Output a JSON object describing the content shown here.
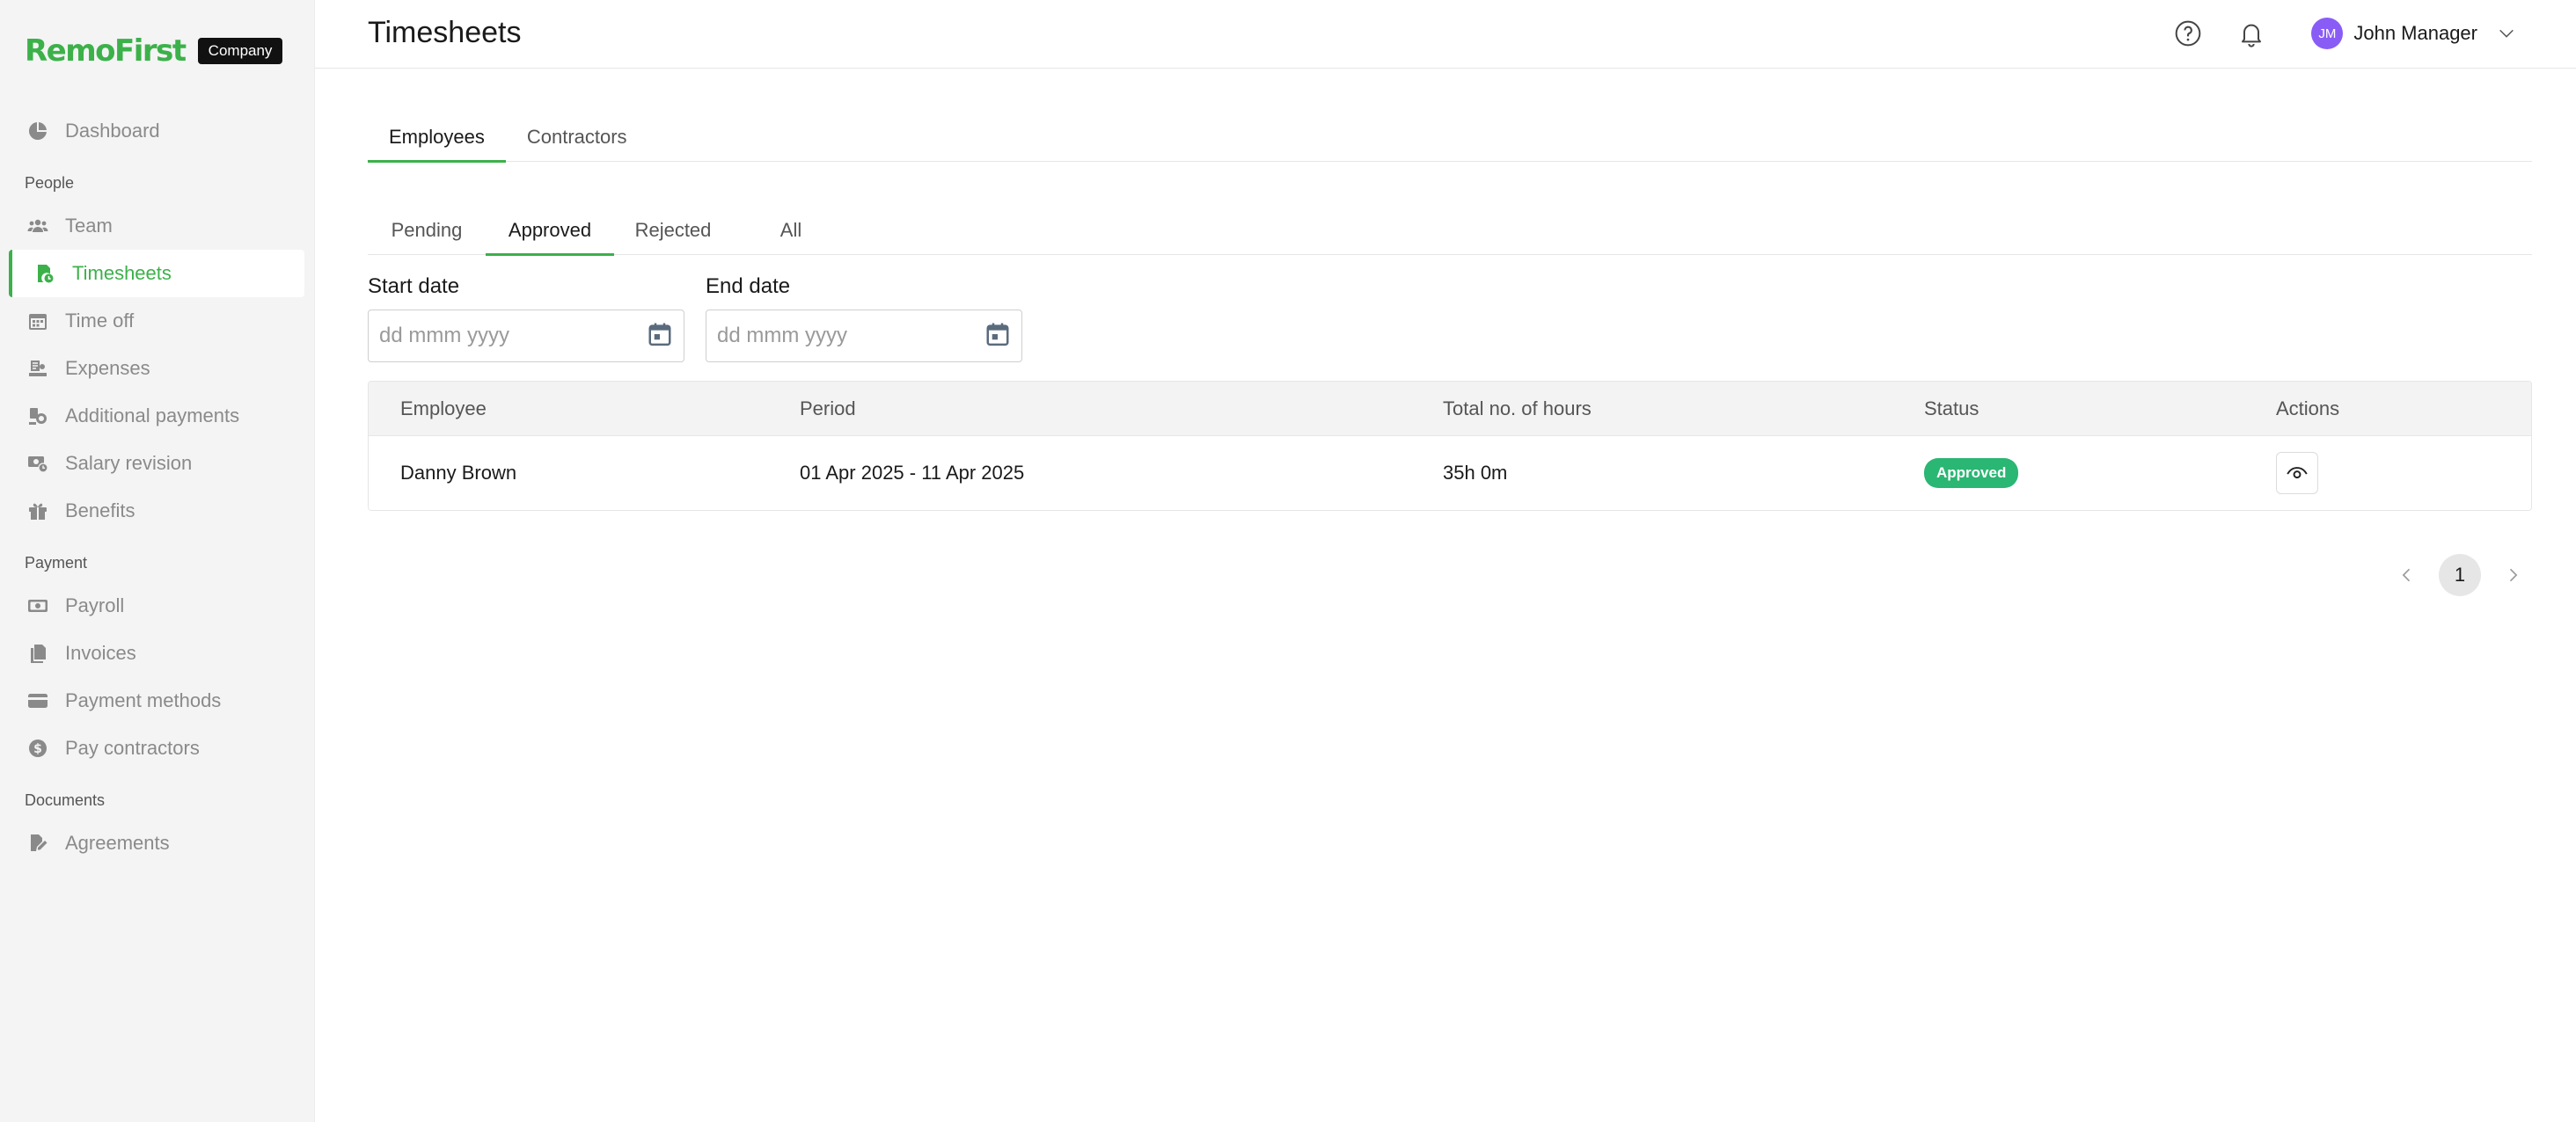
{
  "brand": {
    "logo": "RemoFirst",
    "badge": "Company"
  },
  "sidebar": {
    "items": [
      {
        "label": "Dashboard",
        "icon": "pie-chart-icon"
      },
      {
        "section": "People"
      },
      {
        "label": "Team",
        "icon": "users-icon"
      },
      {
        "label": "Timesheets",
        "icon": "timesheet-icon",
        "active": true
      },
      {
        "label": "Time off",
        "icon": "calendar-icon"
      },
      {
        "label": "Expenses",
        "icon": "receipt-icon"
      },
      {
        "label": "Additional payments",
        "icon": "coins-icon"
      },
      {
        "label": "Salary revision",
        "icon": "money-revision-icon"
      },
      {
        "label": "Benefits",
        "icon": "gift-icon"
      },
      {
        "section": "Payment"
      },
      {
        "label": "Payroll",
        "icon": "banknote-icon"
      },
      {
        "label": "Invoices",
        "icon": "document-icon"
      },
      {
        "label": "Payment methods",
        "icon": "card-icon"
      },
      {
        "label": "Pay contractors",
        "icon": "dollar-circle-icon"
      },
      {
        "section": "Documents"
      },
      {
        "label": "Agreements",
        "icon": "signature-icon"
      }
    ]
  },
  "header": {
    "title": "Timesheets",
    "user": {
      "initials": "JM",
      "name": "John Manager"
    }
  },
  "tabs": {
    "primary": [
      "Employees",
      "Contractors"
    ],
    "primary_active": "Employees",
    "secondary": [
      "Pending",
      "Approved",
      "Rejected",
      "All"
    ],
    "secondary_active": "Approved"
  },
  "filters": {
    "start": {
      "label": "Start date",
      "placeholder": "dd mmm yyyy"
    },
    "end": {
      "label": "End date",
      "placeholder": "dd mmm yyyy"
    }
  },
  "table": {
    "columns": [
      "Employee",
      "Period",
      "Total no. of hours",
      "Status",
      "Actions"
    ],
    "rows": [
      {
        "employee": "Danny Brown",
        "period": "01 Apr 2025 - 11 Apr 2025",
        "hours": "35h 0m",
        "status": "Approved"
      }
    ]
  },
  "pagination": {
    "current": "1"
  },
  "colors": {
    "accent": "#3cb14a",
    "approved": "#2ab673",
    "avatar": "#8a5cf6"
  }
}
